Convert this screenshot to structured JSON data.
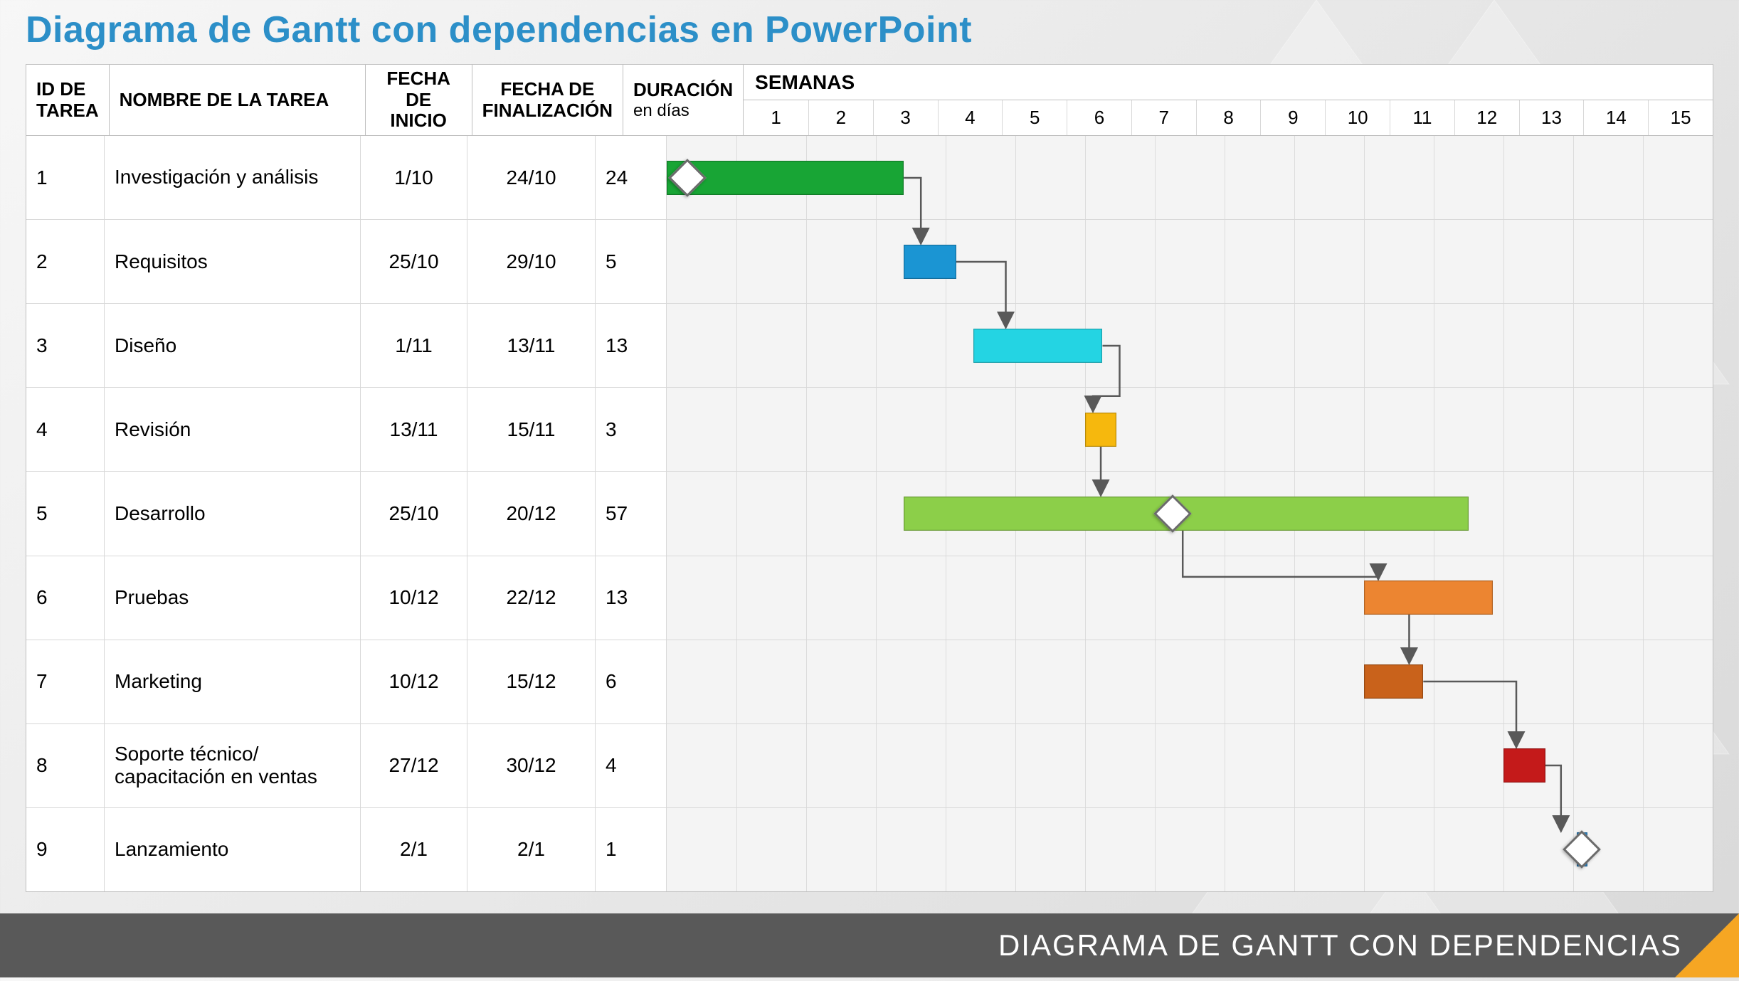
{
  "title": "Diagrama de Gantt con dependencias en PowerPoint",
  "footer": "DIAGRAMA DE GANTT CON DEPENDENCIAS",
  "headers": {
    "id": "ID DE\nTAREA",
    "name": "NOMBRE DE LA TAREA",
    "start": "FECHA DE\nINICIO",
    "end": "FECHA DE\nFINALIZACIÓN",
    "dur": "DURACIÓN",
    "dur_sub": "en días",
    "weeks": "SEMANAS"
  },
  "weeks": [
    "1",
    "2",
    "3",
    "4",
    "5",
    "6",
    "7",
    "8",
    "9",
    "10",
    "11",
    "12",
    "13",
    "14",
    "15"
  ],
  "tasks": [
    {
      "id": "1",
      "name": "Investigación y análisis",
      "start": "1/10",
      "end": "24/10",
      "dur": "24"
    },
    {
      "id": "2",
      "name": "Requisitos",
      "start": "25/10",
      "end": "29/10",
      "dur": "5"
    },
    {
      "id": "3",
      "name": "Diseño",
      "start": "1/11",
      "end": "13/11",
      "dur": "13"
    },
    {
      "id": "4",
      "name": "Revisión",
      "start": "13/11",
      "end": "15/11",
      "dur": "3"
    },
    {
      "id": "5",
      "name": "Desarrollo",
      "start": "25/10",
      "end": "20/12",
      "dur": "57"
    },
    {
      "id": "6",
      "name": "Pruebas",
      "start": "10/12",
      "end": "22/12",
      "dur": "13"
    },
    {
      "id": "7",
      "name": "Marketing",
      "start": "10/12",
      "end": "15/12",
      "dur": "6"
    },
    {
      "id": "8",
      "name": "Soporte técnico/\ncapacitación en ventas",
      "start": "27/12",
      "end": "30/12",
      "dur": "4"
    },
    {
      "id": "9",
      "name": "Lanzamiento",
      "start": "2/1",
      "end": "2/1",
      "dur": "1"
    }
  ],
  "chart_data": {
    "type": "gantt",
    "title": "Diagrama de Gantt con dependencias en PowerPoint",
    "x_unit": "weeks",
    "x_range": [
      1,
      15
    ],
    "rows": [
      {
        "id": 1,
        "name": "Investigación y análisis",
        "start_week": 1.0,
        "end_week": 4.4,
        "color": "#18a535",
        "milestone_at": 1.3
      },
      {
        "id": 2,
        "name": "Requisitos",
        "start_week": 4.4,
        "end_week": 5.15,
        "color": "#1b95d3"
      },
      {
        "id": 3,
        "name": "Diseño",
        "start_week": 5.4,
        "end_week": 7.25,
        "color": "#24d4e3"
      },
      {
        "id": 4,
        "name": "Revisión",
        "start_week": 7.0,
        "end_week": 7.45,
        "color": "#f6b80d"
      },
      {
        "id": 5,
        "name": "Desarrollo",
        "start_week": 4.4,
        "end_week": 12.5,
        "color": "#8ccf49",
        "milestone_at": 8.25
      },
      {
        "id": 6,
        "name": "Pruebas",
        "start_week": 11.0,
        "end_week": 12.85,
        "color": "#ec8531"
      },
      {
        "id": 7,
        "name": "Marketing",
        "start_week": 11.0,
        "end_week": 11.85,
        "color": "#c9621b"
      },
      {
        "id": 8,
        "name": "Soporte técnico / capacitación en ventas",
        "start_week": 13.0,
        "end_week": 13.6,
        "color": "#c41a1a"
      },
      {
        "id": 9,
        "name": "Lanzamiento",
        "start_week": 14.05,
        "end_week": 14.2,
        "color": "#2f87c7",
        "milestone_at": 14.12
      }
    ],
    "dependencies": [
      {
        "from": 1,
        "to": 2
      },
      {
        "from": 2,
        "to": 3
      },
      {
        "from": 3,
        "to": 4
      },
      {
        "from": 4,
        "to": 5
      },
      {
        "from": 5,
        "to": 6
      },
      {
        "from": 6,
        "to": 7
      },
      {
        "from": 7,
        "to": 8
      },
      {
        "from": 8,
        "to": 9
      }
    ]
  }
}
